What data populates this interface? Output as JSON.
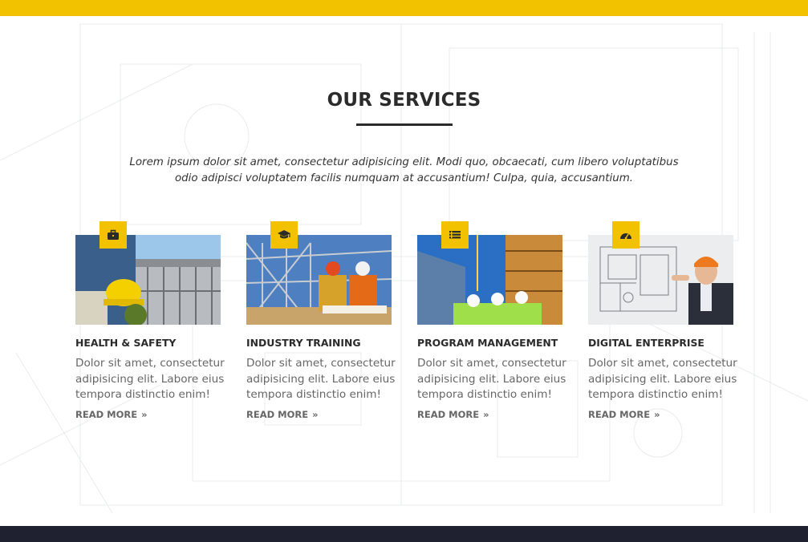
{
  "section": {
    "title": "OUR SERVICES",
    "intro": "Lorem ipsum dolor sit amet, consectetur adipisicing elit. Modi quo, obcaecati, cum libero voluptatibus odio adipisci voluptatem facilis numquam at accusantium! Culpa, quia, accusantium."
  },
  "services": [
    {
      "title": "HEALTH & SAFETY",
      "text": "Dolor sit amet, consectetur adipisicing elit. Labore eius tempora distinctio enim!",
      "link": "READ MORE",
      "arrow": "»",
      "icon": "briefcase-icon"
    },
    {
      "title": "INDUSTRY TRAINING",
      "text": "Dolor sit amet, consectetur adipisicing elit. Labore eius tempora distinctio enim!",
      "link": "READ MORE",
      "arrow": "»",
      "icon": "graduation-cap-icon"
    },
    {
      "title": "PROGRAM MANAGEMENT",
      "text": "Dolor sit amet, consectetur adipisicing elit. Labore eius tempora distinctio enim!",
      "link": "READ MORE",
      "arrow": "»",
      "icon": "list-icon"
    },
    {
      "title": "DIGITAL ENTERPRISE",
      "text": "Dolor sit amet, consectetur adipisicing elit. Labore eius tempora distinctio enim!",
      "link": "READ MORE",
      "arrow": "»",
      "icon": "dashboard-icon"
    }
  ],
  "colors": {
    "accent": "#f2c200",
    "heading": "#2b2b2b",
    "body": "#666666",
    "footer": "#1f2130"
  }
}
